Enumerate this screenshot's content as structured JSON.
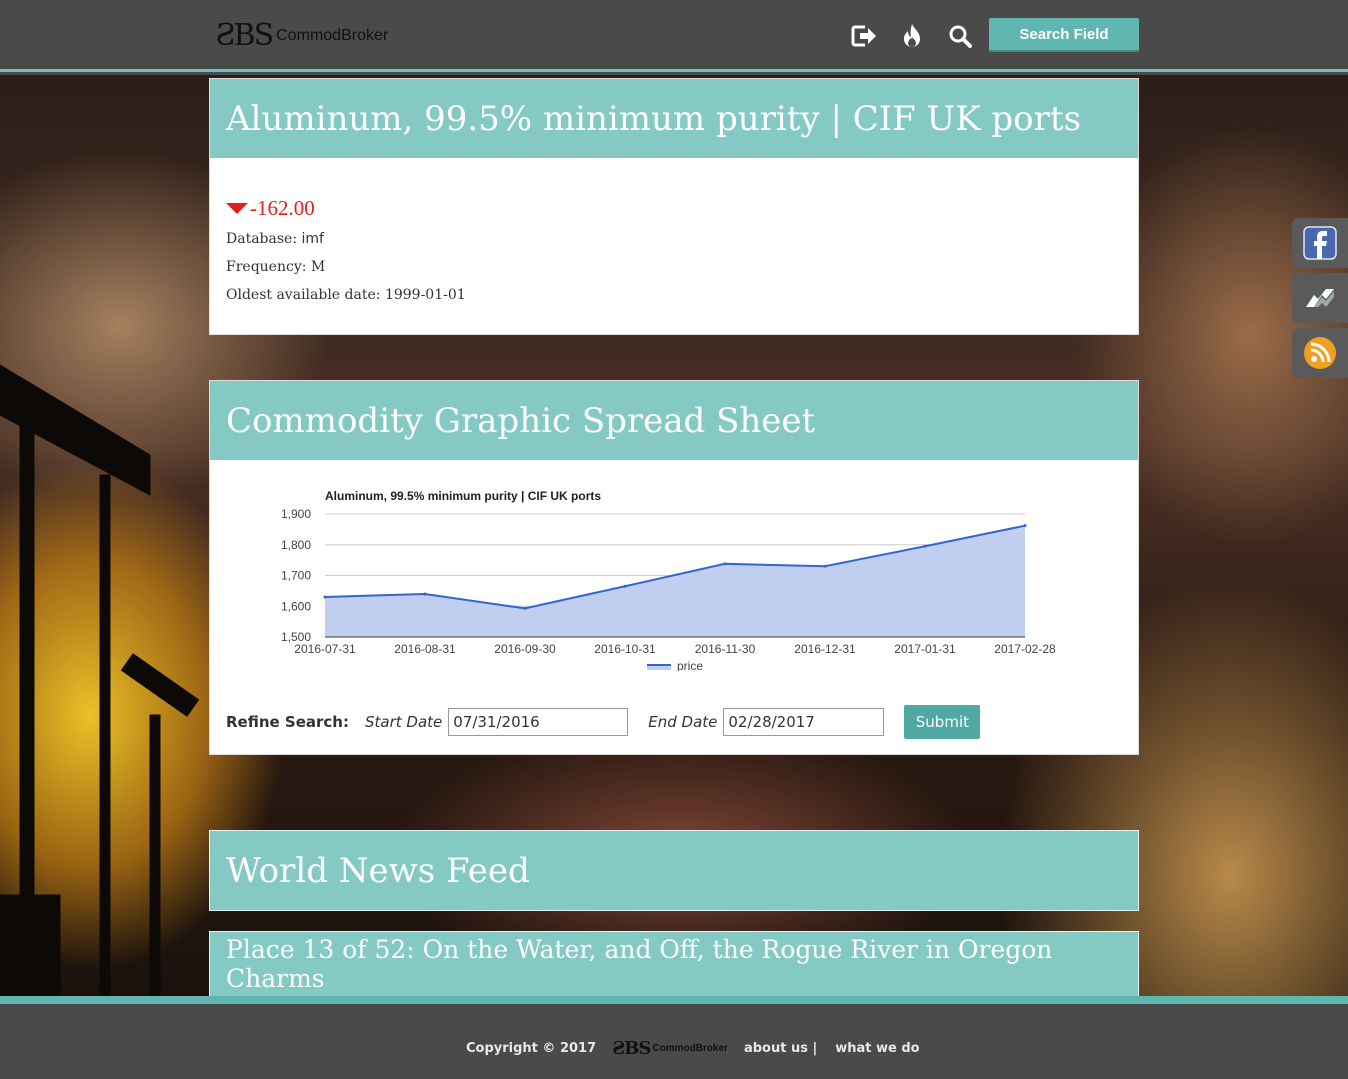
{
  "header": {
    "logo_mark": "ƧBS",
    "logo_text": "CommodBroker",
    "search_button": "Search Field"
  },
  "commodity": {
    "title": "Aluminum, 99.5% minimum purity | CIF UK ports",
    "change": "-162.00",
    "database_label": "Database:",
    "database_value": "imf",
    "frequency_label": "Frequency:",
    "frequency_value": "M",
    "oldest_label": "Oldest available date:",
    "oldest_value": "1999-01-01"
  },
  "spreadsheet": {
    "title": "Commodity Graphic Spread Sheet",
    "refine_label": "Refine Search:",
    "start_label": "Start Date",
    "start_value": "07/31/2016",
    "end_label": "End Date",
    "end_value": "02/28/2017",
    "submit_label": "Submit"
  },
  "chart_data": {
    "type": "area",
    "title": "Aluminum, 99.5% minimum purity | CIF UK ports",
    "x": [
      "2016-07-31",
      "2016-08-31",
      "2016-09-30",
      "2016-10-31",
      "2016-11-30",
      "2016-12-31",
      "2017-01-31",
      "2017-02-28"
    ],
    "series": [
      {
        "name": "price",
        "values": [
          1630,
          1640,
          1593,
          1665,
          1738,
          1730,
          1795,
          1862
        ],
        "color": "#3366cc"
      }
    ],
    "yticks": [
      "1,900",
      "1,800",
      "1,700",
      "1,600",
      "1,500"
    ],
    "ylim": [
      1500,
      1900
    ],
    "grid": true,
    "legend": "bottom"
  },
  "news": {
    "title": "World News Feed",
    "items": [
      {
        "title": "Place 13 of 52: On the Water, and Off, the Rogue River in Oregon Charms"
      }
    ]
  },
  "footer": {
    "copyright": "Copyright © 2017",
    "logo_mark": "ƧBS",
    "logo_text": "CommodBroker",
    "about": "about us |",
    "what": "what we do"
  },
  "colors": {
    "accent": "#85c9c4",
    "button": "#5fb7b0",
    "down": "#e02020",
    "series": "#3366cc",
    "area": "#c0cff0"
  }
}
